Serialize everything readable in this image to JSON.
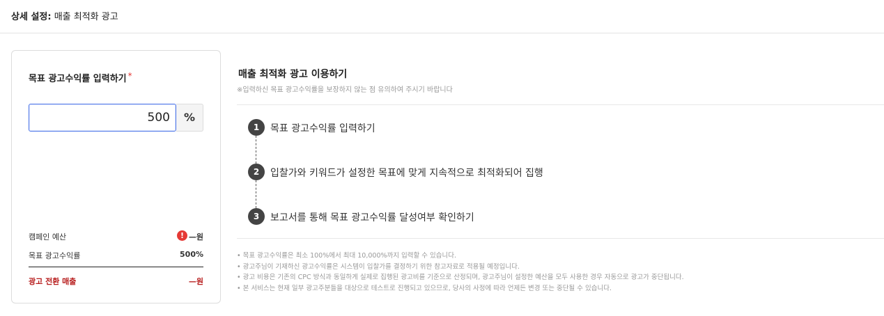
{
  "header": {
    "breadcrumb_bold": "상세 설정:",
    "breadcrumb_rest": " 매출 최적화 광고"
  },
  "target_panel": {
    "title": "목표 광고수익률 입력하기",
    "required_mark": "*",
    "input_value": "500",
    "unit": "%",
    "summary": {
      "budget_label": "캠페인 예산",
      "budget_alert": "!",
      "budget_value": "—원",
      "roas_label": "목표 광고수익률",
      "roas_value": "500%",
      "sales_label": "광고 전환 매출",
      "sales_value": "—원"
    }
  },
  "guide": {
    "title": "매출 최적화 광고 이용하기",
    "subtitle": "※입력하신 목표 광고수익률을 보장하지 않는 점 유의하여 주시기 바랍니다",
    "steps": [
      {
        "num": "1",
        "text": "목표 광고수익률 입력하기"
      },
      {
        "num": "2",
        "text": "입찰가와 키워드가 설정한 목표에 맞게 지속적으로 최적화되어 집행"
      },
      {
        "num": "3",
        "text": "보고서를 통해 목표 광고수익률 달성여부 확인하기"
      }
    ],
    "notes": [
      "• 목표 광고수익률은 최소 100%에서 최대 10,000%까지 입력할 수 있습니다.",
      "• 광고주님이 기재하신 광고수익률은 시스템이 입찰가를 결정하기 위한 참고자료로 적용될 예정입니다.",
      "• 광고 비용은 기존의 CPC 방식과 동일하게 실제로 집행된 광고비를 기준으로 산정되며, 광고주님이 설정한 예산을 모두 사용한 경우 자동으로 광고가 중단됩니다.",
      "• 본 서비스는 현재 일부 광고주분들을 대상으로 테스트로 진행되고 있으므로, 당사의 사정에 따라 언제든 변경 또는 중단될 수 있습니다."
    ]
  },
  "colors": {
    "accent": "#4a73e8",
    "alert": "#e53935",
    "sales": "#b71c1c",
    "step_badge": "#444444"
  }
}
